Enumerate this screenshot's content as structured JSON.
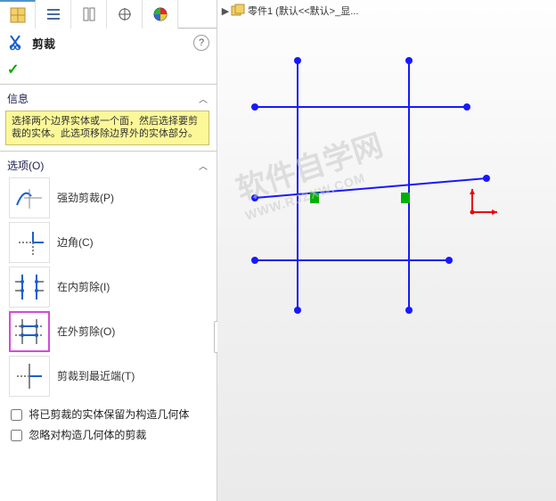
{
  "header": {
    "title": "剪裁",
    "help_glyph": "?"
  },
  "accept_glyph": "✓",
  "info": {
    "title": "信息",
    "text": "选择两个边界实体或一个面，然后选择要剪裁的实体。此选项移除边界外的实体部分。"
  },
  "options": {
    "title": "选项(O)",
    "items": [
      {
        "label": "强劲剪裁(P)"
      },
      {
        "label": "边角(C)"
      },
      {
        "label": "在内剪除(I)"
      },
      {
        "label": "在外剪除(O)"
      },
      {
        "label": "剪裁到最近端(T)"
      }
    ]
  },
  "checkboxes": {
    "cb1": "将已剪裁的实体保留为构造几何体",
    "cb2": "忽略对构造几何体的剪裁"
  },
  "tree": {
    "part_label": "零件1  (默认<<默认>_显..."
  }
}
